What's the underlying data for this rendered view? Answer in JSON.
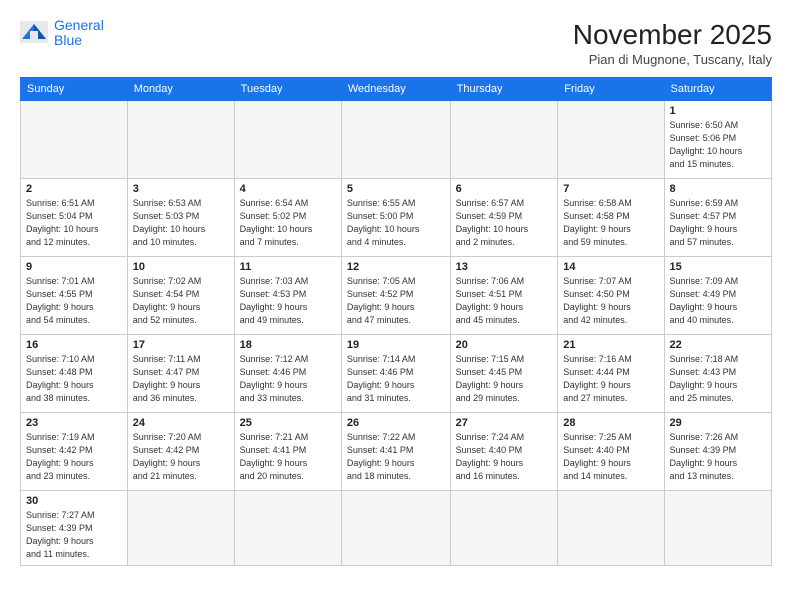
{
  "header": {
    "title": "November 2025",
    "location": "Pian di Mugnone, Tuscany, Italy",
    "logo_general": "General",
    "logo_blue": "Blue"
  },
  "days_of_week": [
    "Sunday",
    "Monday",
    "Tuesday",
    "Wednesday",
    "Thursday",
    "Friday",
    "Saturday"
  ],
  "weeks": [
    [
      {
        "day": "",
        "info": ""
      },
      {
        "day": "",
        "info": ""
      },
      {
        "day": "",
        "info": ""
      },
      {
        "day": "",
        "info": ""
      },
      {
        "day": "",
        "info": ""
      },
      {
        "day": "",
        "info": ""
      },
      {
        "day": "1",
        "info": "Sunrise: 6:50 AM\nSunset: 5:06 PM\nDaylight: 10 hours\nand 15 minutes."
      }
    ],
    [
      {
        "day": "2",
        "info": "Sunrise: 6:51 AM\nSunset: 5:04 PM\nDaylight: 10 hours\nand 12 minutes."
      },
      {
        "day": "3",
        "info": "Sunrise: 6:53 AM\nSunset: 5:03 PM\nDaylight: 10 hours\nand 10 minutes."
      },
      {
        "day": "4",
        "info": "Sunrise: 6:54 AM\nSunset: 5:02 PM\nDaylight: 10 hours\nand 7 minutes."
      },
      {
        "day": "5",
        "info": "Sunrise: 6:55 AM\nSunset: 5:00 PM\nDaylight: 10 hours\nand 4 minutes."
      },
      {
        "day": "6",
        "info": "Sunrise: 6:57 AM\nSunset: 4:59 PM\nDaylight: 10 hours\nand 2 minutes."
      },
      {
        "day": "7",
        "info": "Sunrise: 6:58 AM\nSunset: 4:58 PM\nDaylight: 9 hours\nand 59 minutes."
      },
      {
        "day": "8",
        "info": "Sunrise: 6:59 AM\nSunset: 4:57 PM\nDaylight: 9 hours\nand 57 minutes."
      }
    ],
    [
      {
        "day": "9",
        "info": "Sunrise: 7:01 AM\nSunset: 4:55 PM\nDaylight: 9 hours\nand 54 minutes."
      },
      {
        "day": "10",
        "info": "Sunrise: 7:02 AM\nSunset: 4:54 PM\nDaylight: 9 hours\nand 52 minutes."
      },
      {
        "day": "11",
        "info": "Sunrise: 7:03 AM\nSunset: 4:53 PM\nDaylight: 9 hours\nand 49 minutes."
      },
      {
        "day": "12",
        "info": "Sunrise: 7:05 AM\nSunset: 4:52 PM\nDaylight: 9 hours\nand 47 minutes."
      },
      {
        "day": "13",
        "info": "Sunrise: 7:06 AM\nSunset: 4:51 PM\nDaylight: 9 hours\nand 45 minutes."
      },
      {
        "day": "14",
        "info": "Sunrise: 7:07 AM\nSunset: 4:50 PM\nDaylight: 9 hours\nand 42 minutes."
      },
      {
        "day": "15",
        "info": "Sunrise: 7:09 AM\nSunset: 4:49 PM\nDaylight: 9 hours\nand 40 minutes."
      }
    ],
    [
      {
        "day": "16",
        "info": "Sunrise: 7:10 AM\nSunset: 4:48 PM\nDaylight: 9 hours\nand 38 minutes."
      },
      {
        "day": "17",
        "info": "Sunrise: 7:11 AM\nSunset: 4:47 PM\nDaylight: 9 hours\nand 36 minutes."
      },
      {
        "day": "18",
        "info": "Sunrise: 7:12 AM\nSunset: 4:46 PM\nDaylight: 9 hours\nand 33 minutes."
      },
      {
        "day": "19",
        "info": "Sunrise: 7:14 AM\nSunset: 4:46 PM\nDaylight: 9 hours\nand 31 minutes."
      },
      {
        "day": "20",
        "info": "Sunrise: 7:15 AM\nSunset: 4:45 PM\nDaylight: 9 hours\nand 29 minutes."
      },
      {
        "day": "21",
        "info": "Sunrise: 7:16 AM\nSunset: 4:44 PM\nDaylight: 9 hours\nand 27 minutes."
      },
      {
        "day": "22",
        "info": "Sunrise: 7:18 AM\nSunset: 4:43 PM\nDaylight: 9 hours\nand 25 minutes."
      }
    ],
    [
      {
        "day": "23",
        "info": "Sunrise: 7:19 AM\nSunset: 4:42 PM\nDaylight: 9 hours\nand 23 minutes."
      },
      {
        "day": "24",
        "info": "Sunrise: 7:20 AM\nSunset: 4:42 PM\nDaylight: 9 hours\nand 21 minutes."
      },
      {
        "day": "25",
        "info": "Sunrise: 7:21 AM\nSunset: 4:41 PM\nDaylight: 9 hours\nand 20 minutes."
      },
      {
        "day": "26",
        "info": "Sunrise: 7:22 AM\nSunset: 4:41 PM\nDaylight: 9 hours\nand 18 minutes."
      },
      {
        "day": "27",
        "info": "Sunrise: 7:24 AM\nSunset: 4:40 PM\nDaylight: 9 hours\nand 16 minutes."
      },
      {
        "day": "28",
        "info": "Sunrise: 7:25 AM\nSunset: 4:40 PM\nDaylight: 9 hours\nand 14 minutes."
      },
      {
        "day": "29",
        "info": "Sunrise: 7:26 AM\nSunset: 4:39 PM\nDaylight: 9 hours\nand 13 minutes."
      }
    ],
    [
      {
        "day": "30",
        "info": "Sunrise: 7:27 AM\nSunset: 4:39 PM\nDaylight: 9 hours\nand 11 minutes."
      },
      {
        "day": "",
        "info": ""
      },
      {
        "day": "",
        "info": ""
      },
      {
        "day": "",
        "info": ""
      },
      {
        "day": "",
        "info": ""
      },
      {
        "day": "",
        "info": ""
      },
      {
        "day": "",
        "info": ""
      }
    ]
  ]
}
